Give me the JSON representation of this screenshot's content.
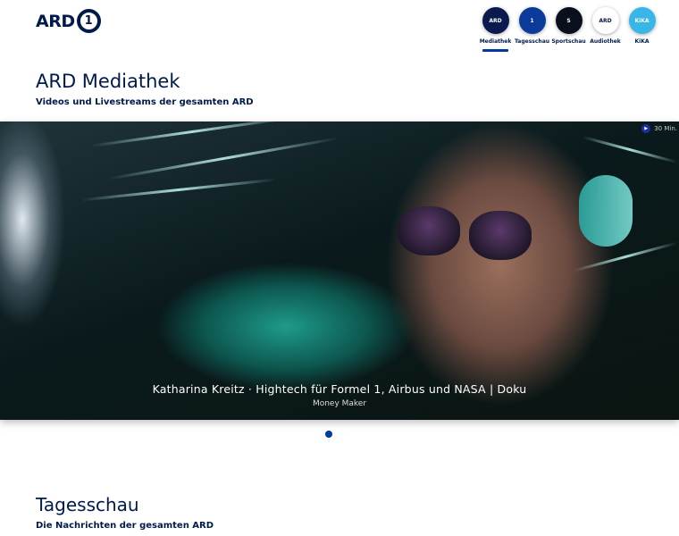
{
  "header": {
    "logo_text": "ARD",
    "logo_mark": "1"
  },
  "nav": [
    {
      "label": "Mediathek",
      "icon": "ARD",
      "color": "#0a1a4f",
      "active": true
    },
    {
      "label": "Tagesschau",
      "icon": "1",
      "color": "#0a3a9a",
      "active": false
    },
    {
      "label": "Sportschau",
      "icon": "S",
      "color": "#0a0f1c",
      "active": false
    },
    {
      "label": "Audiothek",
      "icon": "ARD",
      "color": "#ffffff",
      "active": false
    },
    {
      "label": "KiKA",
      "icon": "KiKA",
      "color": "#38b6e8",
      "active": false
    }
  ],
  "page": {
    "title": "ARD Mediathek",
    "subtitle": "Videos und Livestreams der gesamten ARD"
  },
  "hero": {
    "title": "Katharina Kreitz · Hightech für Formel 1, Airbus und NASA | Doku",
    "series": "Money Maker",
    "duration": "30 Min.",
    "play_icon": "▶"
  },
  "carousel": {
    "pages": 1,
    "current": 1
  },
  "section": {
    "title": "Tagesschau",
    "subtitle": "Die Nachrichten der gesamten ARD"
  }
}
